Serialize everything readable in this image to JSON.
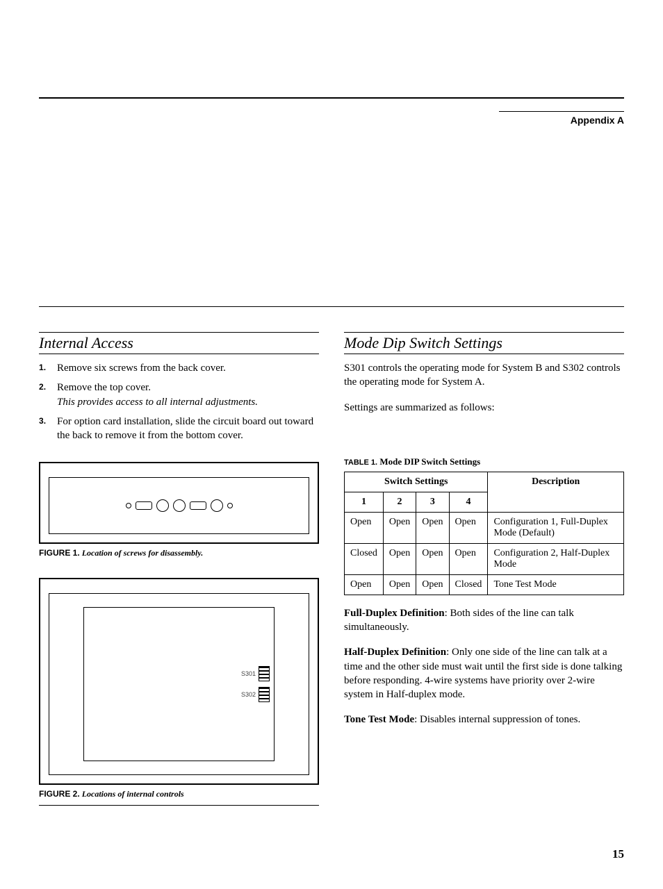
{
  "header": {
    "appendix": "Appendix A"
  },
  "left": {
    "title": "Internal Access",
    "steps": [
      {
        "text": "Remove six screws from the back cover."
      },
      {
        "text": "Remove the top cover.",
        "note": "This provides access to all internal adjustments."
      },
      {
        "text": "For option card installation, slide the circuit board out toward the back to remove it from the bottom cover."
      }
    ],
    "figure1": {
      "label": "FIGURE 1.",
      "title": "Location of screws for disassembly."
    },
    "figure2": {
      "label": "FIGURE 2.",
      "title": "Locations of internal controls",
      "marker1": "S301",
      "marker2": "S302"
    }
  },
  "right": {
    "title": "Mode Dip Switch Settings",
    "intro1": "S301 controls the operating mode for System B and S302 controls the operating mode for System A.",
    "intro2": "Settings are summarized as follows:",
    "table_caption": {
      "label": "TABLE 1.",
      "title": "Mode DIP Switch Settings"
    },
    "table": {
      "group_header": "Switch Settings",
      "desc_header": "Description",
      "cols": [
        "1",
        "2",
        "3",
        "4"
      ],
      "rows": [
        {
          "c": [
            "Open",
            "Open",
            "Open",
            "Open"
          ],
          "desc": "Configuration 1, Full-Duplex Mode (Default)"
        },
        {
          "c": [
            "Closed",
            "Open",
            "Open",
            "Open"
          ],
          "desc": "Configuration 2, Half-Duplex Mode"
        },
        {
          "c": [
            "Open",
            "Open",
            "Open",
            "Closed"
          ],
          "desc": "Tone Test Mode"
        }
      ]
    },
    "defs": [
      {
        "lead": "Full-Duplex Definition",
        "body": ": Both sides of the line can talk simultaneously."
      },
      {
        "lead": "Half-Duplex Definition",
        "body": ": Only one side of the line can talk at a time and the other side must wait until the first side is done talking before responding. 4-wire systems have priority over 2-wire system in Half-duplex mode."
      },
      {
        "lead": "Tone Test Mode",
        "body": ": Disables internal suppression of tones."
      }
    ]
  },
  "page_number": "15"
}
